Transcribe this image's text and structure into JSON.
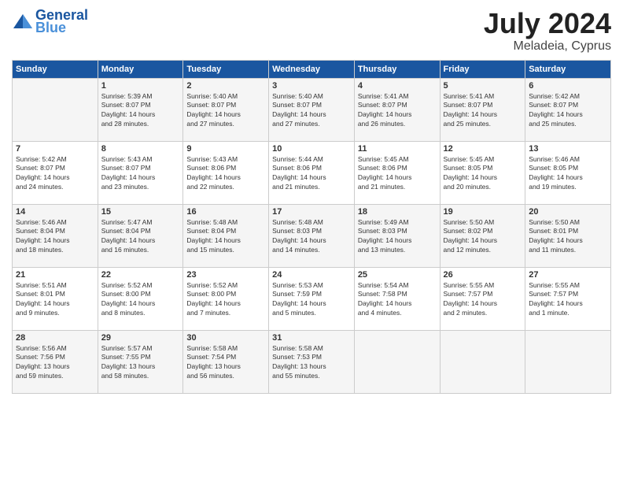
{
  "header": {
    "logo_line1": "General",
    "logo_line2": "Blue",
    "title": "July 2024",
    "location": "Meladeia, Cyprus"
  },
  "weekdays": [
    "Sunday",
    "Monday",
    "Tuesday",
    "Wednesday",
    "Thursday",
    "Friday",
    "Saturday"
  ],
  "weeks": [
    [
      {
        "day": "",
        "info": ""
      },
      {
        "day": "1",
        "info": "Sunrise: 5:39 AM\nSunset: 8:07 PM\nDaylight: 14 hours\nand 28 minutes."
      },
      {
        "day": "2",
        "info": "Sunrise: 5:40 AM\nSunset: 8:07 PM\nDaylight: 14 hours\nand 27 minutes."
      },
      {
        "day": "3",
        "info": "Sunrise: 5:40 AM\nSunset: 8:07 PM\nDaylight: 14 hours\nand 27 minutes."
      },
      {
        "day": "4",
        "info": "Sunrise: 5:41 AM\nSunset: 8:07 PM\nDaylight: 14 hours\nand 26 minutes."
      },
      {
        "day": "5",
        "info": "Sunrise: 5:41 AM\nSunset: 8:07 PM\nDaylight: 14 hours\nand 25 minutes."
      },
      {
        "day": "6",
        "info": "Sunrise: 5:42 AM\nSunset: 8:07 PM\nDaylight: 14 hours\nand 25 minutes."
      }
    ],
    [
      {
        "day": "7",
        "info": "Sunrise: 5:42 AM\nSunset: 8:07 PM\nDaylight: 14 hours\nand 24 minutes."
      },
      {
        "day": "8",
        "info": "Sunrise: 5:43 AM\nSunset: 8:07 PM\nDaylight: 14 hours\nand 23 minutes."
      },
      {
        "day": "9",
        "info": "Sunrise: 5:43 AM\nSunset: 8:06 PM\nDaylight: 14 hours\nand 22 minutes."
      },
      {
        "day": "10",
        "info": "Sunrise: 5:44 AM\nSunset: 8:06 PM\nDaylight: 14 hours\nand 21 minutes."
      },
      {
        "day": "11",
        "info": "Sunrise: 5:45 AM\nSunset: 8:06 PM\nDaylight: 14 hours\nand 21 minutes."
      },
      {
        "day": "12",
        "info": "Sunrise: 5:45 AM\nSunset: 8:05 PM\nDaylight: 14 hours\nand 20 minutes."
      },
      {
        "day": "13",
        "info": "Sunrise: 5:46 AM\nSunset: 8:05 PM\nDaylight: 14 hours\nand 19 minutes."
      }
    ],
    [
      {
        "day": "14",
        "info": "Sunrise: 5:46 AM\nSunset: 8:04 PM\nDaylight: 14 hours\nand 18 minutes."
      },
      {
        "day": "15",
        "info": "Sunrise: 5:47 AM\nSunset: 8:04 PM\nDaylight: 14 hours\nand 16 minutes."
      },
      {
        "day": "16",
        "info": "Sunrise: 5:48 AM\nSunset: 8:04 PM\nDaylight: 14 hours\nand 15 minutes."
      },
      {
        "day": "17",
        "info": "Sunrise: 5:48 AM\nSunset: 8:03 PM\nDaylight: 14 hours\nand 14 minutes."
      },
      {
        "day": "18",
        "info": "Sunrise: 5:49 AM\nSunset: 8:03 PM\nDaylight: 14 hours\nand 13 minutes."
      },
      {
        "day": "19",
        "info": "Sunrise: 5:50 AM\nSunset: 8:02 PM\nDaylight: 14 hours\nand 12 minutes."
      },
      {
        "day": "20",
        "info": "Sunrise: 5:50 AM\nSunset: 8:01 PM\nDaylight: 14 hours\nand 11 minutes."
      }
    ],
    [
      {
        "day": "21",
        "info": "Sunrise: 5:51 AM\nSunset: 8:01 PM\nDaylight: 14 hours\nand 9 minutes."
      },
      {
        "day": "22",
        "info": "Sunrise: 5:52 AM\nSunset: 8:00 PM\nDaylight: 14 hours\nand 8 minutes."
      },
      {
        "day": "23",
        "info": "Sunrise: 5:52 AM\nSunset: 8:00 PM\nDaylight: 14 hours\nand 7 minutes."
      },
      {
        "day": "24",
        "info": "Sunrise: 5:53 AM\nSunset: 7:59 PM\nDaylight: 14 hours\nand 5 minutes."
      },
      {
        "day": "25",
        "info": "Sunrise: 5:54 AM\nSunset: 7:58 PM\nDaylight: 14 hours\nand 4 minutes."
      },
      {
        "day": "26",
        "info": "Sunrise: 5:55 AM\nSunset: 7:57 PM\nDaylight: 14 hours\nand 2 minutes."
      },
      {
        "day": "27",
        "info": "Sunrise: 5:55 AM\nSunset: 7:57 PM\nDaylight: 14 hours\nand 1 minute."
      }
    ],
    [
      {
        "day": "28",
        "info": "Sunrise: 5:56 AM\nSunset: 7:56 PM\nDaylight: 13 hours\nand 59 minutes."
      },
      {
        "day": "29",
        "info": "Sunrise: 5:57 AM\nSunset: 7:55 PM\nDaylight: 13 hours\nand 58 minutes."
      },
      {
        "day": "30",
        "info": "Sunrise: 5:58 AM\nSunset: 7:54 PM\nDaylight: 13 hours\nand 56 minutes."
      },
      {
        "day": "31",
        "info": "Sunrise: 5:58 AM\nSunset: 7:53 PM\nDaylight: 13 hours\nand 55 minutes."
      },
      {
        "day": "",
        "info": ""
      },
      {
        "day": "",
        "info": ""
      },
      {
        "day": "",
        "info": ""
      }
    ]
  ]
}
